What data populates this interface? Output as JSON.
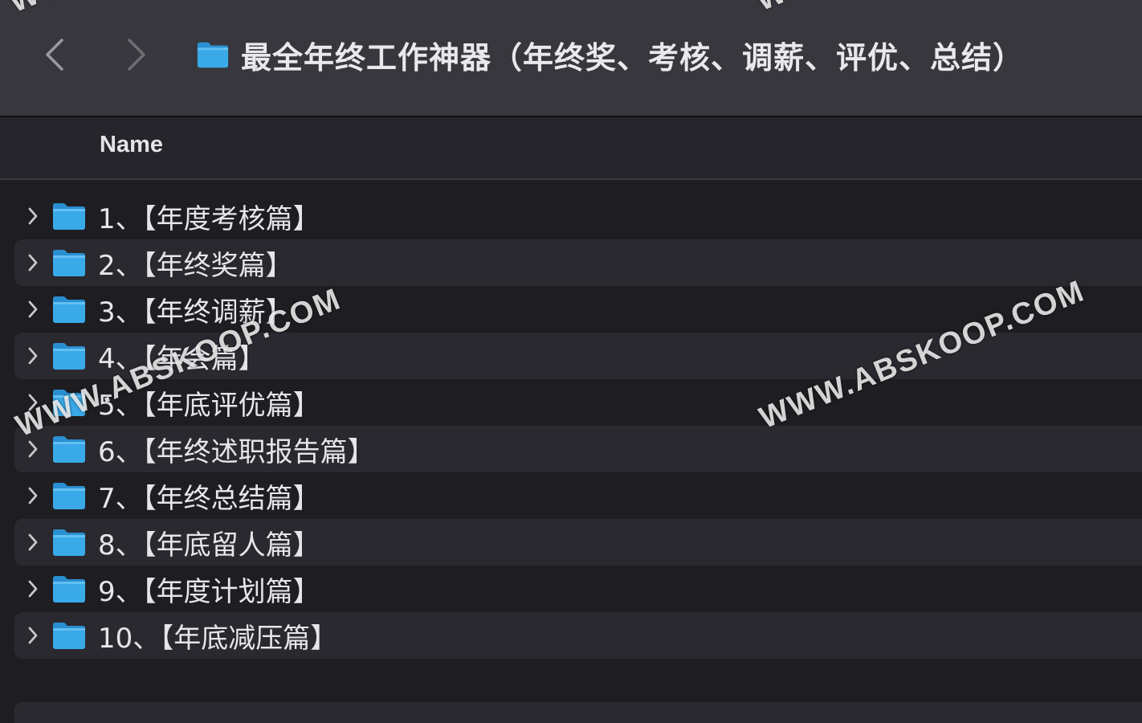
{
  "window": {
    "title": "最全年终工作神器（年终奖、考核、调薪、评优、总结）"
  },
  "toolbar": {
    "back_icon": "chevron-left-icon",
    "forward_icon": "chevron-right-icon",
    "folder_icon": "folder-icon"
  },
  "columns": {
    "name_label": "Name"
  },
  "items": [
    {
      "label": "1、【年度考核篇】"
    },
    {
      "label": "2、【年终奖篇】"
    },
    {
      "label": "3、【年终调薪】"
    },
    {
      "label": "4、【年会篇】"
    },
    {
      "label": "5、【年底评优篇】"
    },
    {
      "label": "6、【年终述职报告篇】"
    },
    {
      "label": "7、【年终总结篇】"
    },
    {
      "label": "8、【年底留人篇】"
    },
    {
      "label": "9、【年度计划篇】"
    },
    {
      "label": "10、【年底减压篇】"
    }
  ],
  "watermarks": [
    "WWW.ABSKOOP.COM",
    "WWW.ABSKOOP.COM",
    "WWW.",
    "WWW."
  ],
  "colors": {
    "toolbar_bg": "#38373d",
    "list_bg": "#1e1e22",
    "row_alt_bg": "#2a292f",
    "folder_blue": "#3aa9e8",
    "text": "#e6e6ea"
  }
}
